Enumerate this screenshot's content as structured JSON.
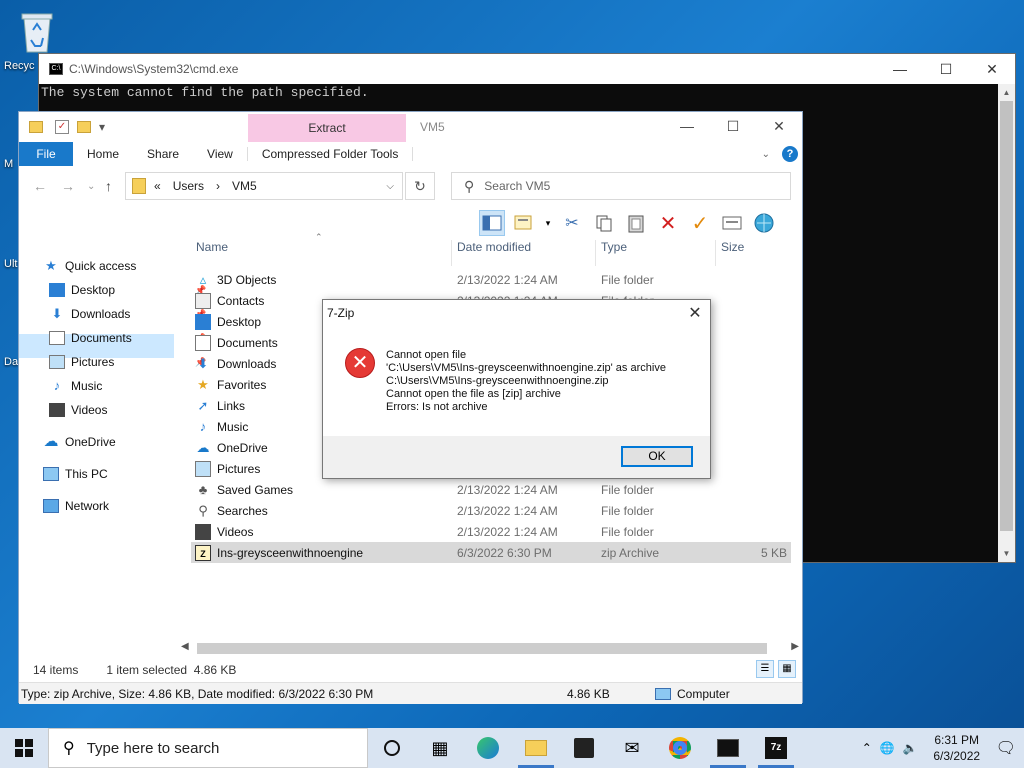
{
  "desktop": {
    "icons": [
      {
        "label": "Recyc",
        "icon": "recycle-bin-icon"
      },
      {
        "label": "Ult",
        "icon": "shortcut-icon"
      },
      {
        "label": "Da",
        "icon": "shortcut-icon"
      },
      {
        "label": "M",
        "icon": "shortcut-icon"
      }
    ]
  },
  "cmd": {
    "title": "C:\\Windows\\System32\\cmd.exe",
    "output": "The system cannot find the path specified."
  },
  "explorer": {
    "title": "VM5",
    "extract_tab": "Extract",
    "ribbon_tabs": [
      "File",
      "Home",
      "Share",
      "View",
      "Compressed Folder Tools"
    ],
    "breadcrumb": [
      "«",
      "Users",
      "›",
      "VM5"
    ],
    "search_placeholder": "Search VM5",
    "columns": {
      "name": "Name",
      "date": "Date modified",
      "type": "Type",
      "size": "Size"
    },
    "nav": [
      {
        "label": "Quick access",
        "icon": "star-icon"
      },
      {
        "label": "Desktop",
        "icon": "desktop-icon",
        "pinned": true
      },
      {
        "label": "Downloads",
        "icon": "download-icon",
        "pinned": true
      },
      {
        "label": "Documents",
        "icon": "documents-icon",
        "pinned": true
      },
      {
        "label": "Pictures",
        "icon": "pictures-icon",
        "pinned": true
      },
      {
        "label": "Music",
        "icon": "music-icon"
      },
      {
        "label": "Videos",
        "icon": "videos-icon"
      },
      {
        "label": "OneDrive",
        "icon": "cloud-icon"
      },
      {
        "label": "This PC",
        "icon": "computer-icon",
        "selected": true
      },
      {
        "label": "Network",
        "icon": "network-icon"
      }
    ],
    "files": [
      {
        "name": "3D Objects",
        "date": "2/13/2022 1:24 AM",
        "type": "File folder",
        "size": "",
        "icon": "3d-objects-icon"
      },
      {
        "name": "Contacts",
        "date": "2/13/2022 1:24 AM",
        "type": "File folder",
        "size": "",
        "icon": "contacts-icon"
      },
      {
        "name": "Desktop",
        "date": "",
        "type": "",
        "size": "",
        "icon": "desktop-icon"
      },
      {
        "name": "Documents",
        "date": "",
        "type": "",
        "size": "",
        "icon": "documents-icon"
      },
      {
        "name": "Downloads",
        "date": "",
        "type": "",
        "size": "",
        "icon": "download-icon"
      },
      {
        "name": "Favorites",
        "date": "",
        "type": "",
        "size": "",
        "icon": "star-icon"
      },
      {
        "name": "Links",
        "date": "",
        "type": "",
        "size": "",
        "icon": "links-icon"
      },
      {
        "name": "Music",
        "date": "",
        "type": "",
        "size": "",
        "icon": "music-icon"
      },
      {
        "name": "OneDrive",
        "date": "",
        "type": "",
        "size": "",
        "icon": "cloud-icon"
      },
      {
        "name": "Pictures",
        "date": "",
        "type": "",
        "size": "",
        "icon": "pictures-icon"
      },
      {
        "name": "Saved Games",
        "date": "2/13/2022 1:24 AM",
        "type": "File folder",
        "size": "",
        "icon": "saved-games-icon"
      },
      {
        "name": "Searches",
        "date": "2/13/2022 1:24 AM",
        "type": "File folder",
        "size": "",
        "icon": "search-icon"
      },
      {
        "name": "Videos",
        "date": "2/13/2022 1:24 AM",
        "type": "File folder",
        "size": "",
        "icon": "videos-icon"
      },
      {
        "name": "Ins-greysceenwithnoengine",
        "date": "6/3/2022 6:30 PM",
        "type": "zip Archive",
        "size": "5 KB",
        "icon": "zip-icon",
        "selected": true
      }
    ],
    "status": {
      "items": "14 items",
      "selected": "1 item selected  4.86 KB"
    },
    "status2": {
      "info": "Type: zip Archive, Size: 4.86 KB, Date modified: 6/3/2022 6:30 PM",
      "size": "4.86 KB",
      "location": "Computer"
    }
  },
  "dialog": {
    "title": "7-Zip",
    "message": "Cannot open file\n'C:\\Users\\VM5\\Ins-greysceenwithnoengine.zip' as archive\nC:\\Users\\VM5\\Ins-greysceenwithnoengine.zip\nCannot open the file as [zip] archive\nErrors: Is not archive",
    "ok": "OK"
  },
  "taskbar": {
    "search_placeholder": "Type here to search",
    "time": "6:31 PM",
    "date": "6/3/2022"
  },
  "colors": {
    "accent": "#1979ca",
    "selection": "#cce8ff",
    "extract_tab": "#f8c8e4",
    "error": "#e53935"
  }
}
